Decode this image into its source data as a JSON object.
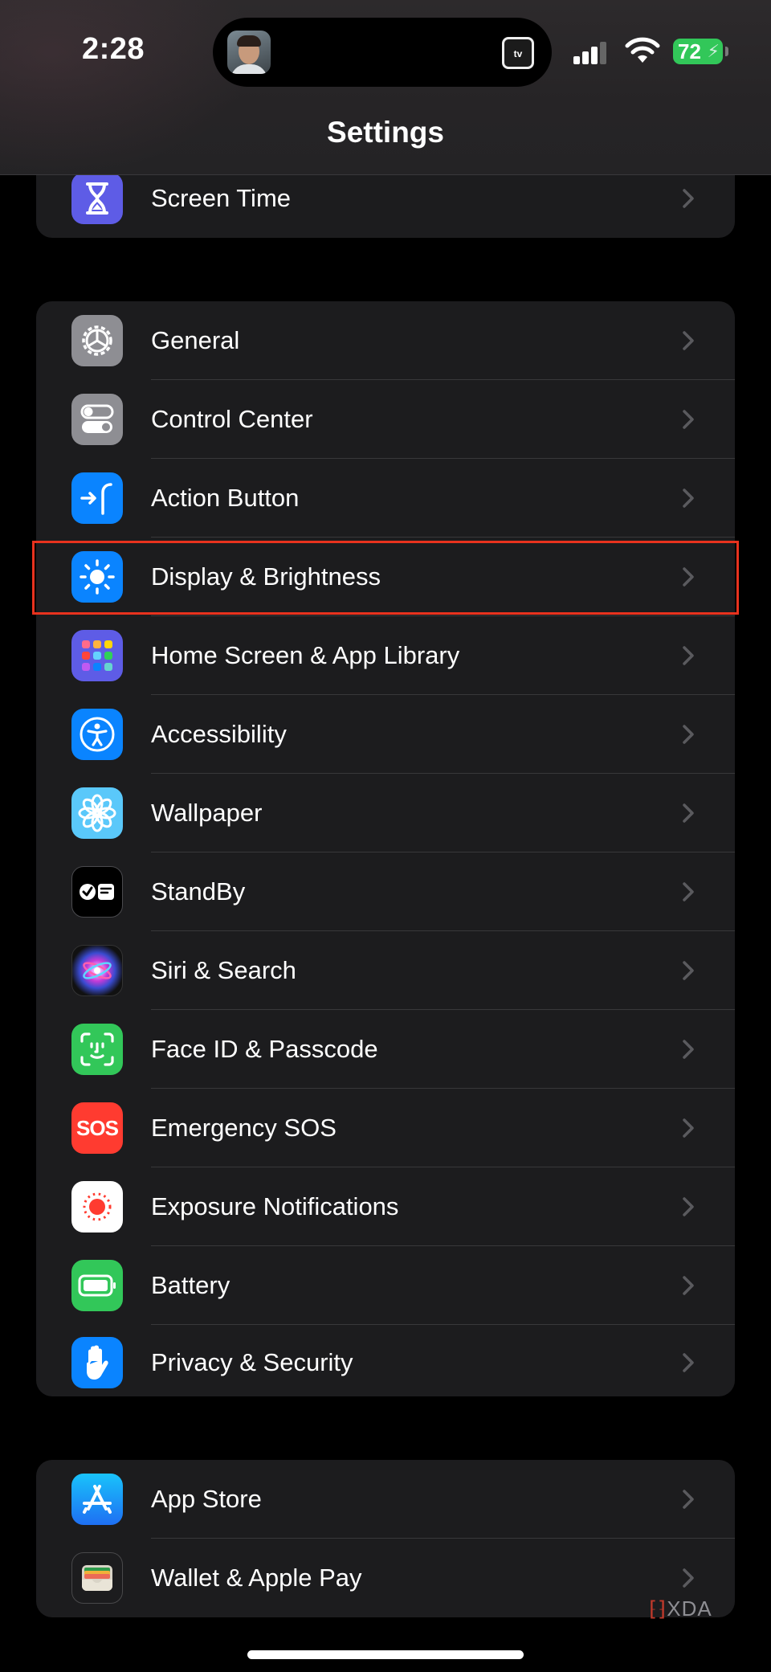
{
  "status_bar": {
    "time": "2:28",
    "battery_level": "72",
    "island_app_label": "tv"
  },
  "nav": {
    "title": "Settings"
  },
  "groups": [
    {
      "items": [
        {
          "label": "Screen Time",
          "icon": "hourglass-icon",
          "color": "#5e5ce6"
        }
      ]
    },
    {
      "items": [
        {
          "label": "General",
          "icon": "gear-icon",
          "color": "#8e8e93"
        },
        {
          "label": "Control Center",
          "icon": "toggles-icon",
          "color": "#8e8e93"
        },
        {
          "label": "Action Button",
          "icon": "action-button-icon",
          "color": "#0a84ff"
        },
        {
          "label": "Display & Brightness",
          "icon": "sun-icon",
          "color": "#0a84ff",
          "highlighted": true
        },
        {
          "label": "Home Screen & App Library",
          "icon": "app-grid-icon",
          "color": "#5e5ce6"
        },
        {
          "label": "Accessibility",
          "icon": "accessibility-icon",
          "color": "#0a84ff"
        },
        {
          "label": "Wallpaper",
          "icon": "flower-icon",
          "color": "#5ac8fa"
        },
        {
          "label": "StandBy",
          "icon": "standby-icon",
          "color": "#000000"
        },
        {
          "label": "Siri & Search",
          "icon": "siri-icon",
          "color": "#1c1c1e"
        },
        {
          "label": "Face ID & Passcode",
          "icon": "face-id-icon",
          "color": "#32c759"
        },
        {
          "label": "Emergency SOS",
          "icon": "sos-icon",
          "color": "#ff3b30",
          "icon_text": "SOS"
        },
        {
          "label": "Exposure Notifications",
          "icon": "exposure-icon",
          "color": "#ffffff"
        },
        {
          "label": "Battery",
          "icon": "battery-icon",
          "color": "#32c759"
        },
        {
          "label": "Privacy & Security",
          "icon": "hand-icon",
          "color": "#0a84ff"
        }
      ]
    },
    {
      "items": [
        {
          "label": "App Store",
          "icon": "app-store-icon",
          "color": "#0a84ff"
        },
        {
          "label": "Wallet & Apple Pay",
          "icon": "wallet-icon",
          "color": "#1c1c1e"
        }
      ]
    }
  ],
  "watermark": "XDA"
}
